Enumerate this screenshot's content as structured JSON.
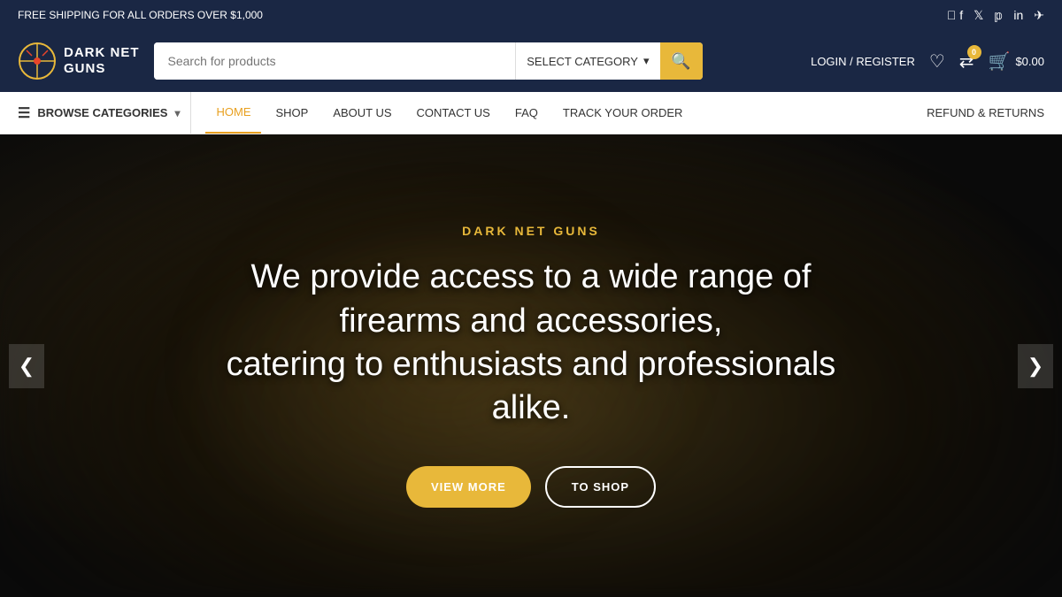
{
  "topbar": {
    "shipping_text": "FREE SHIPPING FOR ALL ORDERS OVER $1,000",
    "social_icons": [
      "facebook",
      "twitter",
      "pinterest",
      "linkedin",
      "telegram"
    ]
  },
  "header": {
    "logo_text_line1": "DARK NET",
    "logo_text_line2": "GUNS",
    "search_placeholder": "Search for products",
    "category_label": "SELECT CATEGORY",
    "search_btn_icon": "🔍",
    "login_label": "LOGIN / REGISTER",
    "compare_badge": "0",
    "cart_price": "$0.00"
  },
  "nav": {
    "browse_label": "BROWSE CATEGORIES",
    "links": [
      {
        "label": "HOME",
        "active": true
      },
      {
        "label": "SHOP",
        "active": false
      },
      {
        "label": "ABOUT US",
        "active": false
      },
      {
        "label": "CONTACT US",
        "active": false
      },
      {
        "label": "FAQ",
        "active": false
      },
      {
        "label": "TRACK YOUR ORDER",
        "active": false
      }
    ],
    "refund_label": "REFUND & RETURNS"
  },
  "hero": {
    "brand": "DARK NET GUNS",
    "title_line1": "We provide access to a wide range of firearms and accessories,",
    "title_line2": "catering to enthusiasts and professionals alike.",
    "btn_view_more": "VIEW MORE",
    "btn_to_shop": "TO SHOP",
    "arrow_left": "❮",
    "arrow_right": "❯"
  }
}
